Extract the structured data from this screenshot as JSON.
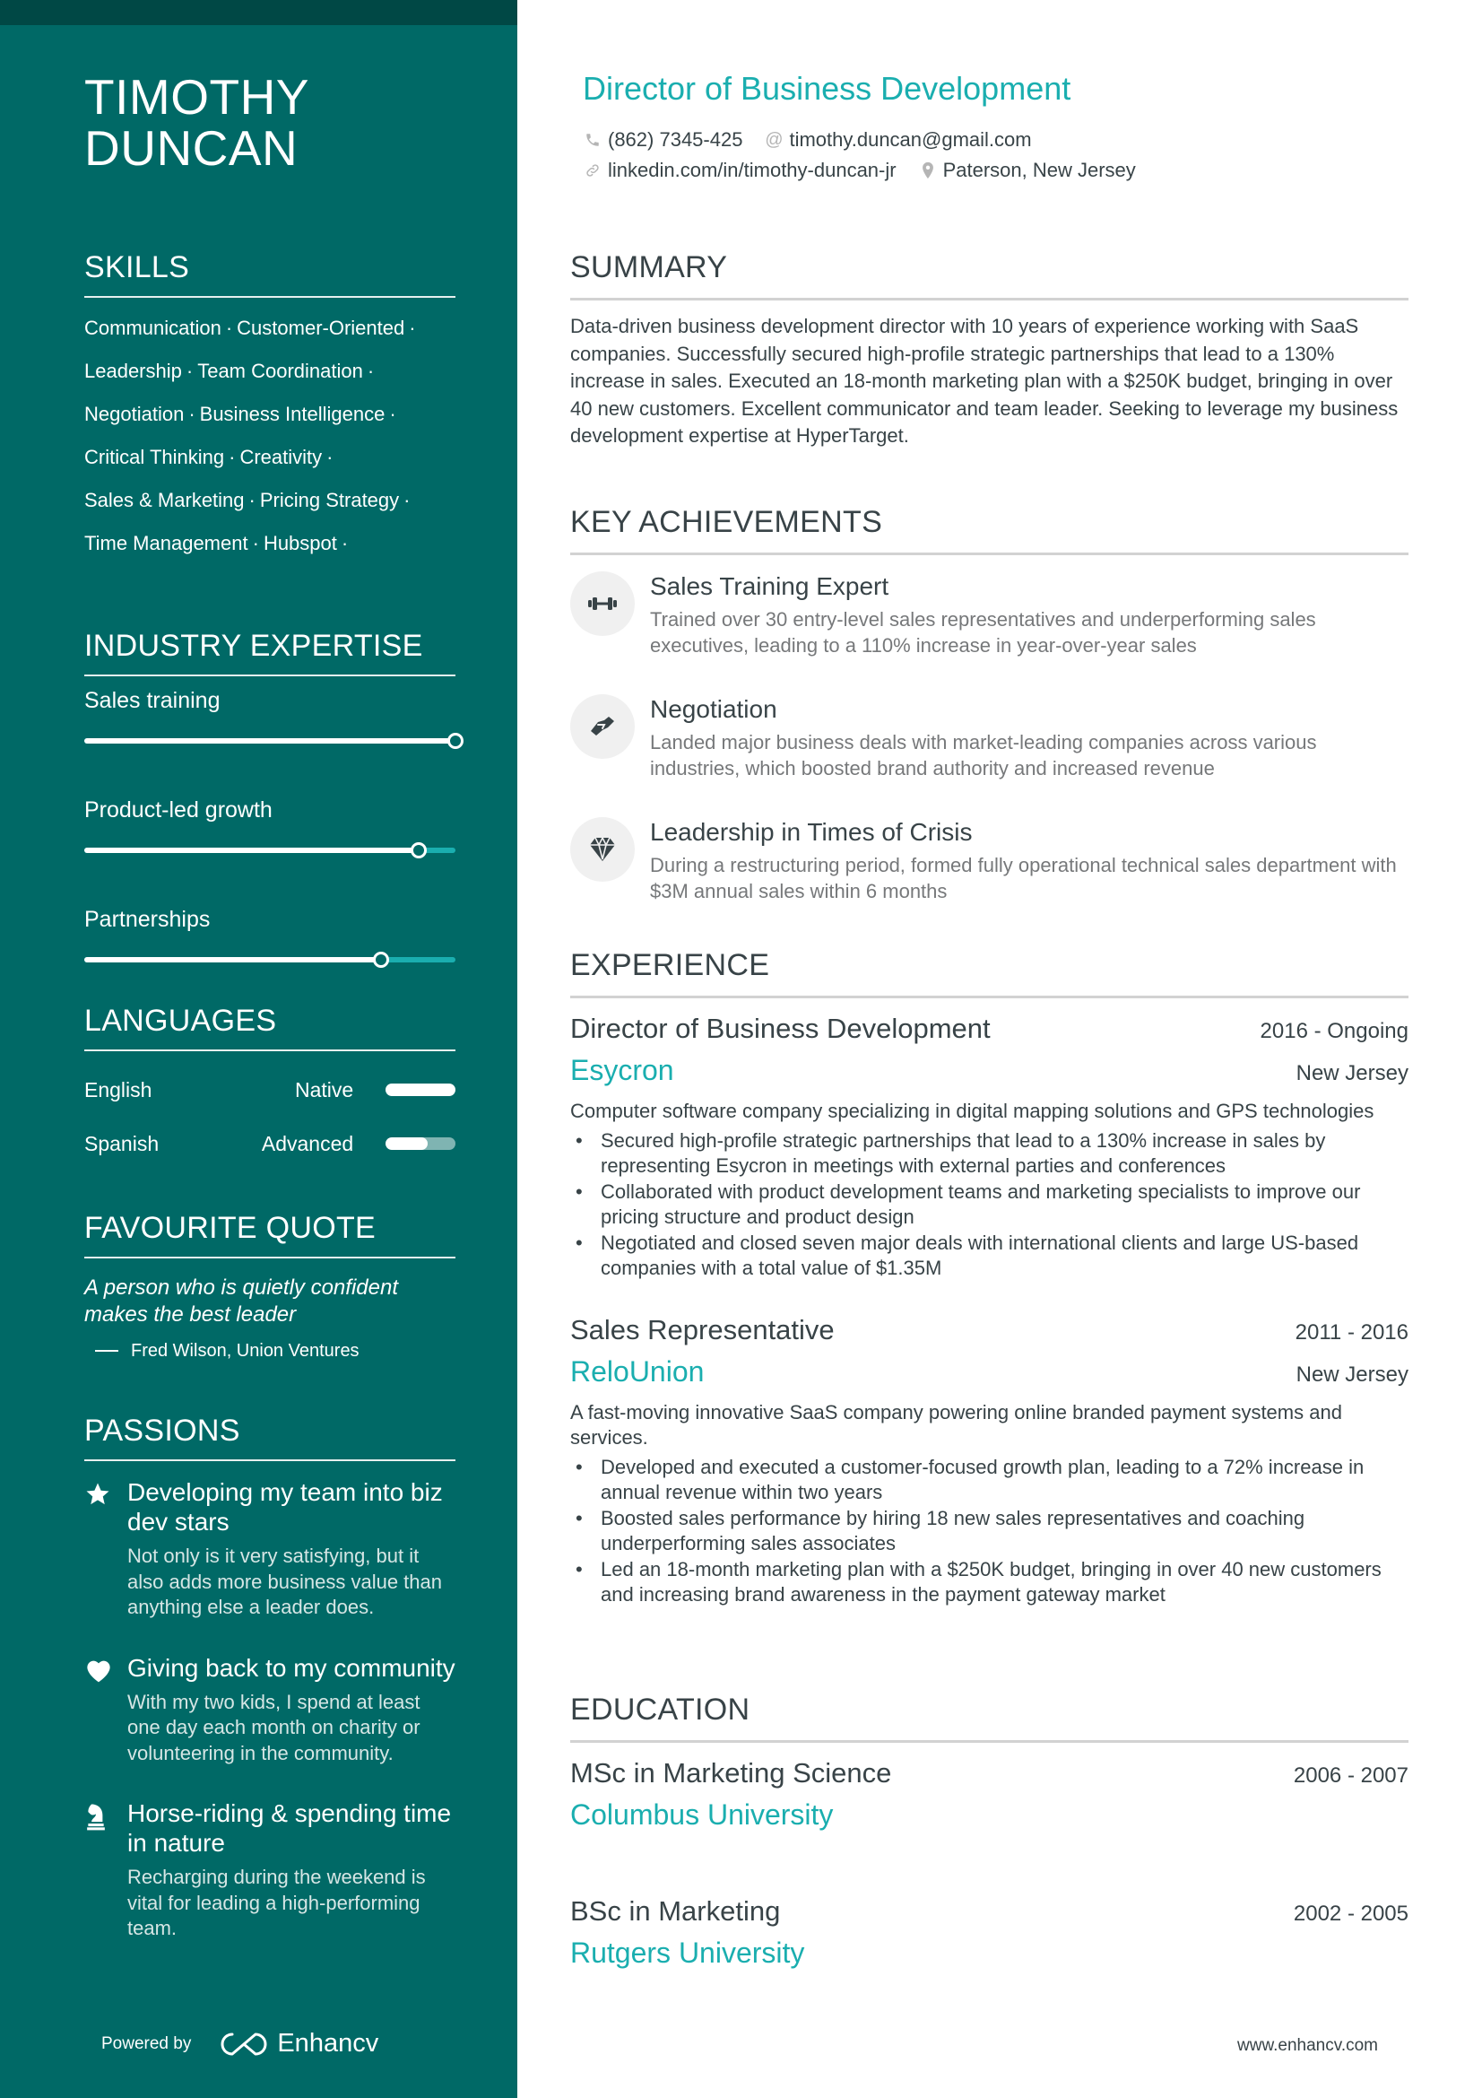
{
  "name": {
    "line1": "TIMOTHY",
    "line2": "DUNCAN"
  },
  "header": {
    "job_title": "Director of Business Development",
    "phone": "(862) 7345-425",
    "email": "timothy.duncan@gmail.com",
    "linkedin": "linkedin.com/in/timothy-duncan-jr",
    "location": "Paterson, New Jersey",
    "icons": {
      "phone": "phone-icon",
      "email": "at-icon",
      "linkedin": "link-icon",
      "location": "map-pin-icon"
    }
  },
  "colors": {
    "sidebar": "#006966",
    "sidebar_top": "#004845",
    "accent": "#1aaeaf",
    "text": "#384347",
    "muted": "#76787a"
  },
  "sidebar": {
    "skills": {
      "title": "SKILLS",
      "lines": [
        [
          "Communication",
          "Customer-Oriented"
        ],
        [
          "Leadership",
          "Team Coordination"
        ],
        [
          "Negotiation",
          "Business Intelligence"
        ],
        [
          "Critical Thinking",
          "Creativity"
        ],
        [
          "Sales & Marketing",
          "Pricing Strategy"
        ],
        [
          "Time Management",
          "Hubspot"
        ]
      ],
      "separator": "·"
    },
    "expertise": {
      "title": "INDUSTRY EXPERTISE",
      "items": [
        {
          "label": "Sales training",
          "level": 1.0
        },
        {
          "label": "Product-led growth",
          "level": 0.9
        },
        {
          "label": "Partnerships",
          "level": 0.8
        }
      ]
    },
    "languages": {
      "title": "LANGUAGES",
      "items": [
        {
          "name": "English",
          "level": "Native",
          "proficiency": 1.0
        },
        {
          "name": "Spanish",
          "level": "Advanced",
          "proficiency": 0.6
        }
      ]
    },
    "quote": {
      "title": "FAVOURITE QUOTE",
      "text": "A person who is quietly confident makes the best leader",
      "author": "Fred Wilson, Union Ventures"
    },
    "passions": {
      "title": "PASSIONS",
      "items": [
        {
          "icon": "star-icon",
          "title": "Developing my team into biz dev stars",
          "desc": "Not only is it very satisfying, but it also adds more business value than anything else a leader does."
        },
        {
          "icon": "heart-icon",
          "title": "Giving back to my community",
          "desc": "With my two kids, I spend at least one day each month on charity or volunteering in the community."
        },
        {
          "icon": "chess-knight-icon",
          "title": "Horse-riding & spending time in nature",
          "desc": "Recharging during the weekend is vital for leading a high-performing team."
        }
      ]
    },
    "powered_by": "Powered by",
    "brand": "Enhancv"
  },
  "summary": {
    "title": "SUMMARY",
    "text": "Data-driven business development director with 10 years of experience working with SaaS companies. Successfully secured high-profile strategic partnerships that lead to a 130% increase in sales. Executed an 18-month marketing plan with a $250K budget, bringing in over 40 new customers. Excellent communicator and team leader. Seeking to leverage my business development expertise at HyperTarget."
  },
  "achievements": {
    "title": "KEY ACHIEVEMENTS",
    "items": [
      {
        "icon": "dumbbell-icon",
        "title": "Sales Training Expert",
        "desc": "Trained over 30 entry-level sales representatives and underperforming sales executives, leading to a 110% increase in year-over-year sales"
      },
      {
        "icon": "handshake-icon",
        "title": "Negotiation",
        "desc": "Landed major business deals with market-leading companies across various industries, which boosted brand authority and increased revenue"
      },
      {
        "icon": "diamond-icon",
        "title": "Leadership in Times of Crisis",
        "desc": "During a restructuring period, formed fully operational technical sales department with $3M annual sales within 6 months"
      }
    ]
  },
  "experience": {
    "title": "EXPERIENCE",
    "items": [
      {
        "role": "Director of Business Development",
        "dates": "2016 - Ongoing",
        "company": "Esycron",
        "location": "New Jersey",
        "desc": "Computer software company specializing in digital mapping solutions and GPS technologies",
        "bullets": [
          "Secured high-profile strategic partnerships that lead to a 130% increase in sales by representing Esycron in meetings with external parties and conferences",
          "Collaborated with product development teams and marketing specialists to improve our pricing structure and product design",
          "Negotiated and closed seven major deals with international clients and large US-based companies with a total value of $1.35M"
        ]
      },
      {
        "role": "Sales Representative",
        "dates": "2011 - 2016",
        "company": "ReloUnion",
        "location": "New Jersey",
        "desc": "A fast-moving innovative SaaS company powering online branded payment systems and services.",
        "bullets": [
          "Developed and executed a customer-focused growth plan, leading to a 72% increase in annual revenue within two years",
          "Boosted sales performance by hiring 18 new sales representatives and coaching underperforming sales associates",
          "Led an 18-month marketing plan with a $250K budget, bringing in over 40 new customers and increasing brand awareness in the payment gateway market"
        ]
      }
    ]
  },
  "education": {
    "title": "EDUCATION",
    "items": [
      {
        "degree": "MSc in Marketing Science",
        "dates": "2006 - 2007",
        "school": "Columbus University"
      },
      {
        "degree": "BSc in Marketing",
        "dates": "2002 - 2005",
        "school": "Rutgers University"
      }
    ]
  },
  "footer": {
    "url": "www.enhancv.com"
  }
}
